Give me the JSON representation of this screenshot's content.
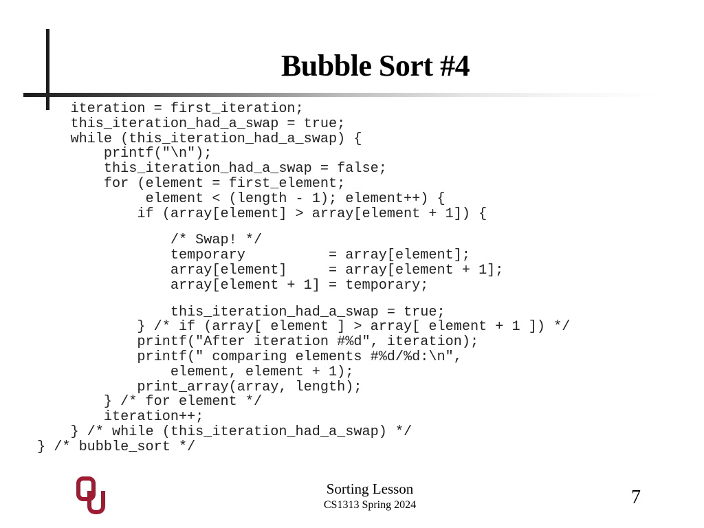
{
  "slide": {
    "title": "Bubble Sort #4",
    "code_lines": [
      "    iteration = first_iteration;",
      "    this_iteration_had_a_swap = true;",
      "    while (this_iteration_had_a_swap) {",
      "        printf(\"\\n\");",
      "        this_iteration_had_a_swap = false;",
      "        for (element = first_element;",
      "             element < (length - 1); element++) {",
      "            if (array[element] > array[element + 1]) {",
      "",
      "                /* Swap! */",
      "                temporary          = array[element];",
      "                array[element]     = array[element + 1];",
      "                array[element + 1] = temporary;",
      "",
      "                this_iteration_had_a_swap = true;",
      "            } /* if (array[ element ] > array[ element + 1 ]) */",
      "            printf(\"After iteration #%d\", iteration);",
      "            printf(\" comparing elements #%d/%d:\\n\",",
      "                element, element + 1);",
      "            print_array(array, length);",
      "        } /* for element */",
      "        iteration++;",
      "    } /* while (this_iteration_had_a_swap) */",
      "} /* bubble_sort */"
    ]
  },
  "footer": {
    "logo_icon": "ou-logo-icon",
    "logo_color": "#9e1b32",
    "course_title": "Sorting Lesson",
    "course_term": "CS1313 Spring 2024",
    "page_number": "7"
  }
}
